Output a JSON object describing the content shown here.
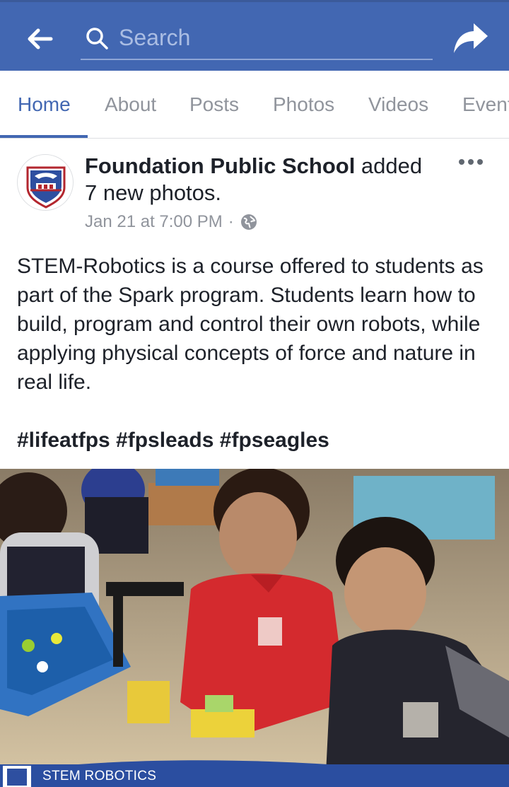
{
  "search": {
    "placeholder": "Search"
  },
  "tabs": [
    {
      "label": "Home",
      "active": true
    },
    {
      "label": "About"
    },
    {
      "label": "Posts"
    },
    {
      "label": "Photos"
    },
    {
      "label": "Videos"
    },
    {
      "label": "Events"
    }
  ],
  "post": {
    "page_name": "Foundation Public School",
    "action": " added 7 new photos.",
    "timestamp": "Jan 21 at 7:00 PM",
    "separator": "·",
    "privacy_icon": "globe-icon",
    "body": "STEM-Robotics is a course offered to students as part of the Spark program. Students learn how to build, program and control their own robots, while applying physical concepts of force and nature in real life.",
    "hashtags": "#lifeatfps #fpsleads #fpseagles",
    "photo_caption": "STEM ROBOTICS"
  },
  "colors": {
    "brand_blue": "#4267b2",
    "text": "#1d2129",
    "muted": "#90949c"
  }
}
